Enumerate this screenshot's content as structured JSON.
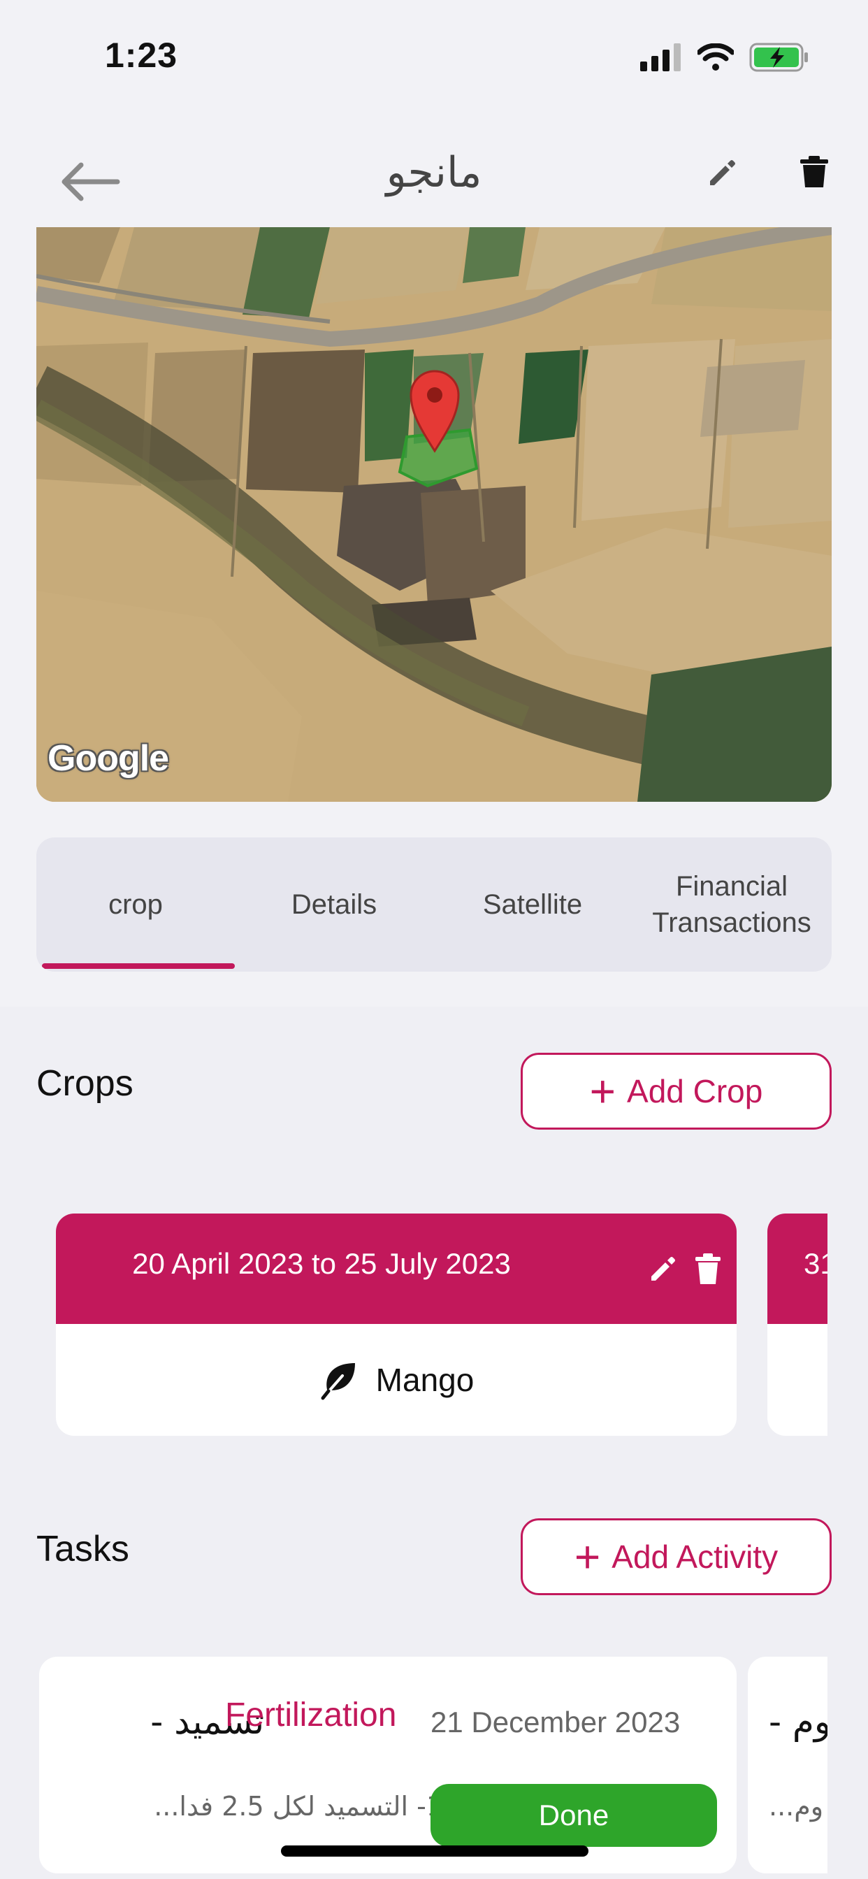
{
  "status_bar": {
    "time": "1:23"
  },
  "header": {
    "title": "مانجو"
  },
  "map": {
    "attribution": "Google"
  },
  "tabs": [
    {
      "label": "crop",
      "selected": true
    },
    {
      "label": "Details",
      "selected": false
    },
    {
      "label": "Satellite",
      "selected": false
    },
    {
      "label": "Financial Transactions",
      "selected": false
    }
  ],
  "crops_section": {
    "title": "Crops",
    "add_button_label": "Add Crop",
    "cards": [
      {
        "dates": "20 April 2023 to 25 July 2023",
        "name": "Mango"
      }
    ],
    "peek_card_text": "31"
  },
  "tasks_section": {
    "title": "Tasks",
    "add_button_label": "Add Activity",
    "cards": [
      {
        "title": "تسميد -",
        "type": "Fertilization",
        "date": "21 December 2023",
        "description": "1- التسميد لكل 2.5 فدا...",
        "status": "Done"
      }
    ],
    "peek_card_title": "وم -",
    "peek_card_description": "وم..."
  },
  "colors": {
    "accent": "#c2185b",
    "done": "#2ea52a",
    "background": "#f2f2f6"
  }
}
